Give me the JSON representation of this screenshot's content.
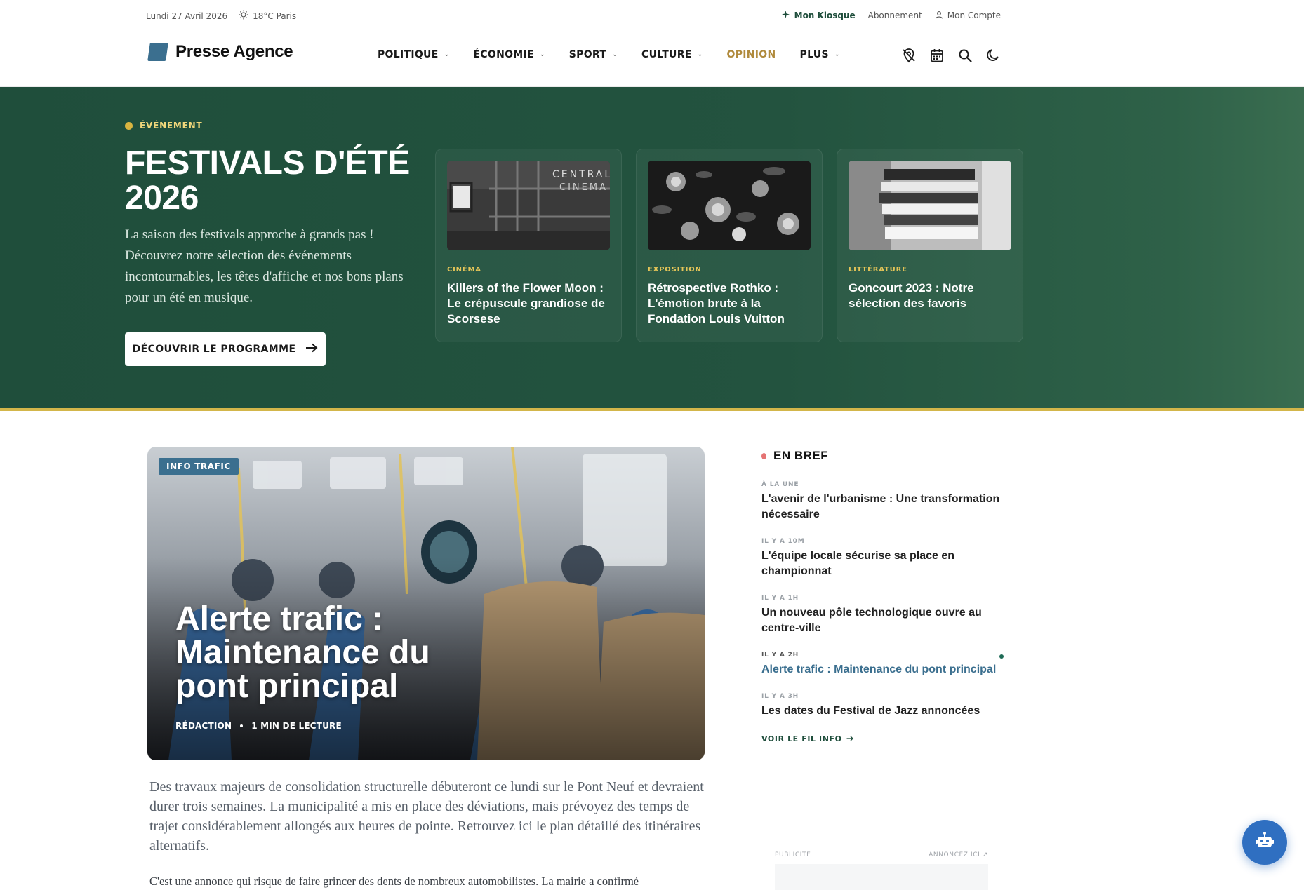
{
  "topbar": {
    "date": "Lundi 27 Avril 2026",
    "weather": "18°C Paris",
    "kiosque": "Mon Kiosque",
    "abonnement": "Abonnement",
    "compte": "Mon Compte"
  },
  "header": {
    "logo": "Presse Agence",
    "nav": [
      {
        "label": "POLITIQUE",
        "dropdown": true
      },
      {
        "label": "ÉCONOMIE",
        "dropdown": true
      },
      {
        "label": "SPORT",
        "dropdown": true
      },
      {
        "label": "CULTURE",
        "dropdown": true
      },
      {
        "label": "OPINION",
        "dropdown": false
      },
      {
        "label": "PLUS",
        "dropdown": true
      }
    ],
    "icons": [
      "location-off-icon",
      "calendar-icon",
      "search-icon",
      "moon-icon"
    ]
  },
  "hero": {
    "tag": "ÉVÉNEMENT",
    "title": "FESTIVALS D'ÉTÉ 2026",
    "description": "La saison des festivals approche à grands pas ! Découvrez notre sélection des événements incontournables, les têtes d'affiche et nos bons plans pour un été en musique.",
    "button": "DÉCOUVRIR LE PROGRAMME",
    "cards": [
      {
        "category": "CINÉMA",
        "title": "Killers of the Flower Moon : Le crépuscule grandiose de Scorsese"
      },
      {
        "category": "EXPOSITION",
        "title": "Rétrospective Rothko : L'émotion brute à la Fondation Louis Vuitton"
      },
      {
        "category": "LITTÉRATURE",
        "title": "Goncourt 2023 : Notre sélection des favoris"
      }
    ]
  },
  "feature": {
    "badge": "INFO TRAFIC",
    "title": "Alerte trafic : Maintenance du pont principal",
    "author": "RÉDACTION",
    "read_time": "1 MIN DE LECTURE",
    "lead": "Des travaux majeurs de consolidation structurelle débuteront ce lundi sur le Pont Neuf et devraient durer trois semaines. La municipalité a mis en place des déviations, mais prévoyez des temps de trajet considérablement allongés aux heures de pointe. Retrouvez ici le plan détaillé des itinéraires alternatifs.",
    "body": "C'est une annonce qui risque de faire grincer des dents de nombreux automobilistes. La mairie a confirmé"
  },
  "bref": {
    "heading": "EN BREF",
    "items": [
      {
        "time": "À LA UNE",
        "title": "L'avenir de l'urbanisme : Une transformation nécessaire"
      },
      {
        "time": "IL Y A 10M",
        "title": "L'équipe locale sécurise sa place en championnat"
      },
      {
        "time": "IL Y A 1H",
        "title": "Un nouveau pôle technologique ouvre au centre-ville"
      },
      {
        "time": "IL Y A 2H",
        "title": "Alerte trafic : Maintenance du pont principal"
      },
      {
        "time": "IL Y A 3H",
        "title": "Les dates du Festival de Jazz annoncées"
      }
    ],
    "more": "VOIR LE FIL INFO"
  },
  "pub": {
    "label": "PUBLICITÉ",
    "link": "ANNONCEZ ICI"
  },
  "colors": {
    "hero_bg": "#1f4e3b",
    "accent_gold": "#d3b64a",
    "accent_blue": "#3b6f8f",
    "chatbot": "#2f6fc1"
  }
}
